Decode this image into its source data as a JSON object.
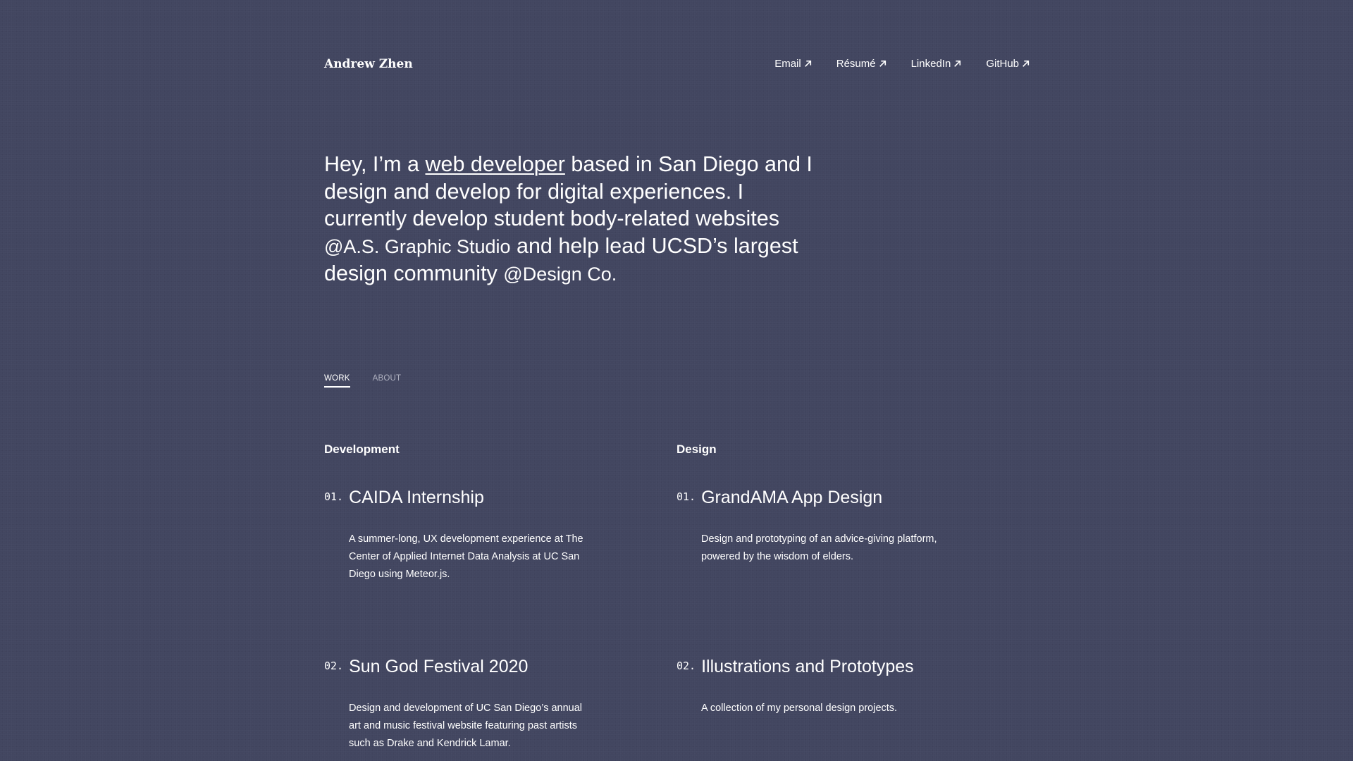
{
  "header": {
    "logo": "Andrew Zhen",
    "nav": [
      {
        "label": "Email",
        "icon": "arrow-up-right-icon"
      },
      {
        "label": "Résumé",
        "icon": "arrow-up-right-icon"
      },
      {
        "label": "LinkedIn",
        "icon": "arrow-up-right-icon"
      },
      {
        "label": "GitHub",
        "icon": "arrow-up-right-icon"
      }
    ]
  },
  "hero": {
    "part1": "Hey, I’m a ",
    "link": "web developer",
    "part2": " based in San Diego and I design and develop for digital experiences. I currently develop student body-related websites ",
    "org1": "@A.S. Graphic Studio",
    "part3": " and help lead UCSD’s largest design community ",
    "org2": "@Design Co."
  },
  "tabs": [
    {
      "label": "WORK",
      "active": true
    },
    {
      "label": "ABOUT",
      "active": false
    }
  ],
  "sections": {
    "development": {
      "title": "Development",
      "projects": [
        {
          "num": "01.",
          "title": "CAIDA Internship",
          "desc": "A summer-long, UX development experience at The Center of Applied Internet Data Analysis at UC San Diego using Meteor.js."
        },
        {
          "num": "02.",
          "title": "Sun God Festival 2020",
          "desc": "Design and development of UC San Diego’s annual art and music festival website featuring past artists such as Drake and Kendrick Lamar."
        }
      ]
    },
    "design": {
      "title": "Design",
      "projects": [
        {
          "num": "01.",
          "title": "GrandAMA App Design",
          "desc": "Design and prototyping of an advice-giving platform, powered by the wisdom of elders."
        },
        {
          "num": "02.",
          "title": "Illustrations and Prototypes",
          "desc": "A collection of my personal design projects."
        }
      ]
    }
  },
  "colors": {
    "background": "#424660",
    "text": "#ffffff",
    "muted": "#aeb0bf"
  }
}
